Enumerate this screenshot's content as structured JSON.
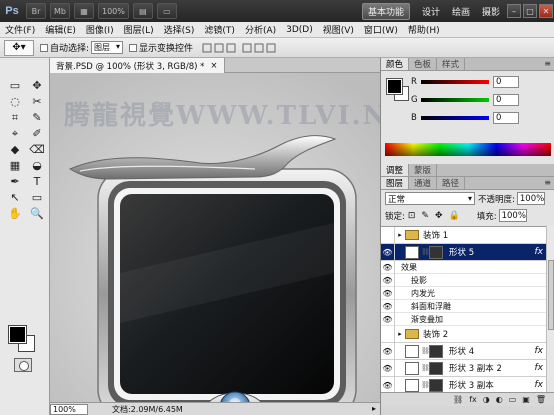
{
  "appbar": {
    "logo": "Ps",
    "zoom": "100%",
    "br_btn": "Br",
    "mb_btn": "Mb",
    "workspaces": [
      "基本功能",
      "设计",
      "绘画",
      "摄影"
    ],
    "window_buttons": [
      "–",
      "□",
      "✕"
    ]
  },
  "menubar": {
    "items": [
      "文件(F)",
      "编辑(E)",
      "图像(I)",
      "图层(L)",
      "选择(S)",
      "滤镜(T)",
      "分析(A)",
      "3D(D)",
      "视图(V)",
      "窗口(W)",
      "帮助(H)"
    ]
  },
  "options": {
    "auto_select_label": "自动选择:",
    "auto_select_value": "图层",
    "show_transform_label": "显示变换控件"
  },
  "toolbox": {
    "tools": [
      "▭",
      "✥",
      "◌",
      "✂",
      "⌗",
      "✎",
      "⌖",
      "✐",
      "◆",
      "⌫",
      "▦",
      "◒",
      "✒",
      "T",
      "↖",
      "▭",
      "✋",
      "🔍"
    ]
  },
  "document": {
    "tab_title": "背景.PSD @ 100% (形状 3, RGB/8) *",
    "watermark": "腾龍視覺WWW.TLVI.NET",
    "zoom_value": "100%",
    "doc_info": "文档:2.09M/6.45M"
  },
  "color_panel": {
    "tabs": [
      "颜色",
      "色板",
      "样式"
    ],
    "r_label": "R",
    "g_label": "G",
    "b_label": "B",
    "r_value": "0",
    "g_value": "0",
    "b_value": "0"
  },
  "adjust_panel": {
    "tabs": [
      "调整",
      "蒙版"
    ]
  },
  "layers_panel": {
    "tabs": [
      "图层",
      "通道",
      "路径"
    ],
    "blend_mode": "正常",
    "opacity_label": "不透明度:",
    "opacity_value": "100%",
    "lock_label": "锁定:",
    "fill_label": "填充:",
    "fill_value": "100%",
    "layers": [
      {
        "name": "装饰 1",
        "type": "group"
      },
      {
        "name": "形状 5",
        "type": "shape",
        "selected": true,
        "fx": "fx"
      },
      {
        "name": "效果",
        "type": "effect-header"
      },
      {
        "name": "投影",
        "type": "effect"
      },
      {
        "name": "内发光",
        "type": "effect"
      },
      {
        "name": "斜面和浮雕",
        "type": "effect"
      },
      {
        "name": "渐变叠加",
        "type": "effect"
      },
      {
        "name": "装饰 2",
        "type": "group"
      },
      {
        "name": "形状 4",
        "type": "shape",
        "fx": "fx"
      },
      {
        "name": "形状 3 副本 2",
        "type": "shape",
        "fx": "fx"
      },
      {
        "name": "形状 3 副本",
        "type": "shape",
        "fx": "fx"
      }
    ],
    "bottom_icons": [
      "⛓",
      "fx",
      "◑",
      "◐",
      "▭",
      "▣",
      "🗑"
    ]
  }
}
